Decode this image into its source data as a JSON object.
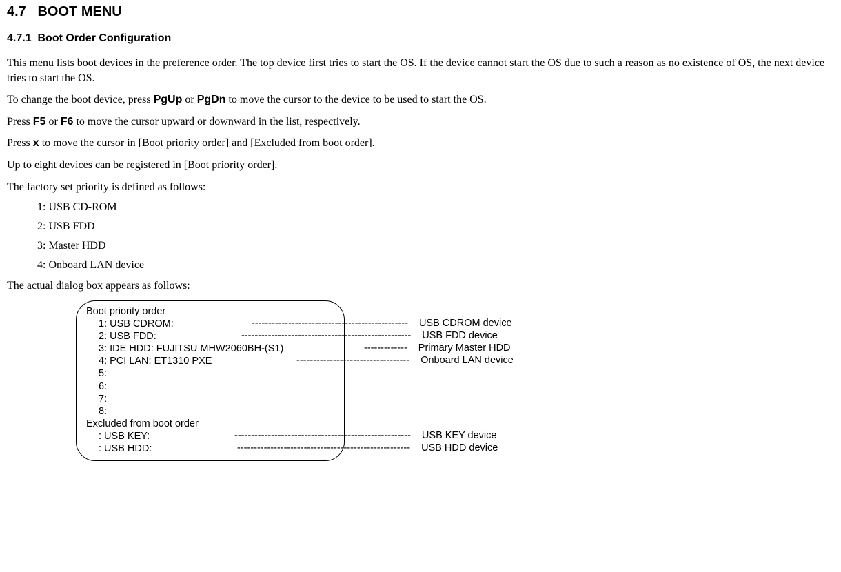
{
  "section": {
    "number": "4.7",
    "title": "BOOT MENU"
  },
  "subsection": {
    "number": "4.7.1",
    "title": "Boot Order Configuration"
  },
  "para1": "This menu lists boot devices in the preference order. The top device first tries to start the OS. If the device cannot start the OS due to such a reason as no existence of OS, the next device tries to start the OS.",
  "para2a": "To change the boot device, press ",
  "key_pgup": "PgUp",
  "para2b": " or ",
  "key_pgdn": "PgDn",
  "para2c": " to move the cursor to the device to be used to start the OS.",
  "para3a": "Press ",
  "key_f5": "F5",
  "para3b": " or ",
  "key_f6": "F6",
  "para3c": " to move the cursor upward or downward in the list, respectively.",
  "para4a": "Press ",
  "key_x": "x",
  "para4b": " to move the cursor in [Boot priority order] and [Excluded from boot order].",
  "para5": "Up to eight devices can be registered in [Boot priority order].",
  "para6": "The factory set priority is defined as follows:",
  "factory": {
    "i1": "1: USB CD-ROM",
    "i2": "2: USB FDD",
    "i3": "3: Master HDD",
    "i4": "4: Onboard LAN device"
  },
  "para7": "The actual dialog box appears as follows:",
  "dialog": {
    "hdr1": "Boot priority order",
    "r1": "1: USB CDROM:",
    "r2": "2: USB FDD:",
    "r3": "3: IDE HDD: FUJITSU MHW2060BH-(S1)",
    "r4": "4: PCI LAN: ET1310 PXE",
    "r5": "5:",
    "r6": "6:",
    "r7": "7:",
    "r8": "8:",
    "hdr2": "Excluded from boot order",
    "e1": ": USB KEY:",
    "e2": ": USB HDD:"
  },
  "callouts": {
    "d1": "-----------------------------------------------",
    "l1": "USB CDROM device",
    "d2": "---------------------------------------------------",
    "l2": "USB FDD device",
    "d3": "-------------",
    "l3": "Primary Master HDD",
    "d4": "----------------------------------",
    "l4": "Onboard LAN device",
    "d5": "-----------------------------------------------------",
    "l5": "USB KEY device",
    "d6": "----------------------------------------------------",
    "l6": "USB HDD device"
  }
}
